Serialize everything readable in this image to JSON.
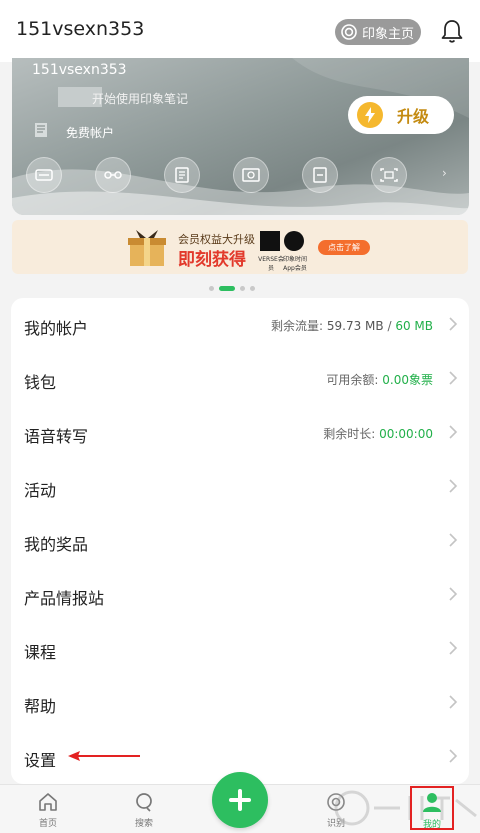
{
  "header": {
    "username": "151vsexn353",
    "home_label": "印象主页",
    "home_icon": "circle-e-icon",
    "bell_icon": "bell-icon"
  },
  "profile_card": {
    "username": "151vsexn353",
    "hint": "开始使用印象笔记",
    "account_type": "免费帐户",
    "upgrade_label": "升级",
    "perk_icons": [
      "sync-icon",
      "share-icon",
      "document-icon",
      "money-icon",
      "scan-icon",
      "present-icon"
    ],
    "more_glyph": "›"
  },
  "banner": {
    "line1": "会员权益大升级",
    "line2": "即刻获得",
    "verse_label": "VERSE会员",
    "app_label": "印象时间App会员",
    "cta_label": "点击了解"
  },
  "carousel": {
    "page_count": 4,
    "active_index": 1
  },
  "menu": {
    "items": [
      {
        "label": "我的帐户",
        "meta_label": "剩余流量:",
        "meta_value": "59.73 MB",
        "meta_sep": " / ",
        "meta_value2": "60 MB"
      },
      {
        "label": "钱包",
        "meta_label": "可用余额:",
        "meta_value": "",
        "meta_sep": "",
        "meta_value2": "0.00象票"
      },
      {
        "label": "语音转写",
        "meta_label": "剩余时长:",
        "meta_value": "",
        "meta_sep": "",
        "meta_value2": "00:00:00"
      },
      {
        "label": "活动"
      },
      {
        "label": "我的奖品"
      },
      {
        "label": "产品情报站"
      },
      {
        "label": "课程"
      },
      {
        "label": "帮助"
      },
      {
        "label": "设置"
      }
    ]
  },
  "tabbar": {
    "tabs": [
      {
        "label": "首页",
        "icon": "home-icon"
      },
      {
        "label": "搜索",
        "icon": "search-icon"
      },
      {
        "label": "识别",
        "icon": "scan-icon"
      },
      {
        "label": "我的",
        "icon": "user-icon"
      }
    ],
    "add_icon": "plus-icon"
  },
  "colors": {
    "accent": "#2dbe60",
    "highlight_box": "#e32222",
    "upgrade_text": "#c48b12"
  }
}
